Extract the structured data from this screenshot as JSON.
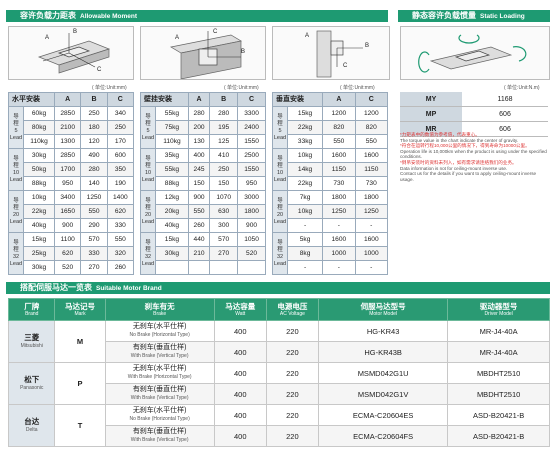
{
  "moment_header": {
    "cn": "容许负载力距表",
    "en": "Allowable Moment"
  },
  "static_header": {
    "cn": "静态容许负载惯量",
    "en": "Static Loading Moment"
  },
  "unit_text": "( 单位:Unit:mm)",
  "unit_text2": "( 单位:Unit:N.m)",
  "fig_labels": {
    "f1": [
      "A",
      "B",
      "C"
    ],
    "f2": [
      "A",
      "B",
      "C"
    ],
    "f3": [
      "A",
      "B",
      "C"
    ]
  },
  "horizontal": {
    "title": "水平安装",
    "cols": [
      "A",
      "B",
      "C"
    ],
    "groups": [
      {
        "lead": [
          "导",
          "程",
          "5",
          "Lead"
        ],
        "rows": [
          [
            "60kg",
            "2850",
            "250",
            "340"
          ],
          [
            "80kg",
            "2100",
            "180",
            "250"
          ],
          [
            "110kg",
            "1300",
            "120",
            "170"
          ]
        ]
      },
      {
        "lead": [
          "导",
          "程",
          "10",
          "Lead"
        ],
        "rows": [
          [
            "30kg",
            "2850",
            "490",
            "600"
          ],
          [
            "50kg",
            "1700",
            "280",
            "350"
          ],
          [
            "88kg",
            "950",
            "140",
            "190"
          ]
        ]
      },
      {
        "lead": [
          "导",
          "程",
          "20",
          "Lead"
        ],
        "rows": [
          [
            "10kg",
            "3400",
            "1250",
            "1400"
          ],
          [
            "22kg",
            "1650",
            "550",
            "620"
          ],
          [
            "40kg",
            "900",
            "290",
            "330"
          ]
        ]
      },
      {
        "lead": [
          "导",
          "程",
          "32",
          "Lead"
        ],
        "rows": [
          [
            "15kg",
            "1100",
            "570",
            "550"
          ],
          [
            "25kg",
            "620",
            "330",
            "320"
          ],
          [
            "30kg",
            "520",
            "270",
            "260"
          ]
        ]
      }
    ]
  },
  "wall": {
    "title": "壁挂安装",
    "cols": [
      "A",
      "B",
      "C"
    ],
    "groups": [
      {
        "lead": [
          "导",
          "程",
          "5",
          "Lead"
        ],
        "rows": [
          [
            "55kg",
            "280",
            "280",
            "3300"
          ],
          [
            "75kg",
            "200",
            "195",
            "2400"
          ],
          [
            "110kg",
            "130",
            "125",
            "1550"
          ]
        ]
      },
      {
        "lead": [
          "导",
          "程",
          "10",
          "Lead"
        ],
        "rows": [
          [
            "35kg",
            "400",
            "410",
            "2500"
          ],
          [
            "55kg",
            "245",
            "250",
            "1550"
          ],
          [
            "88kg",
            "150",
            "150",
            "950"
          ]
        ]
      },
      {
        "lead": [
          "导",
          "程",
          "20",
          "Lead"
        ],
        "rows": [
          [
            "12kg",
            "900",
            "1070",
            "3000"
          ],
          [
            "20kg",
            "550",
            "630",
            "1800"
          ],
          [
            "40kg",
            "260",
            "300",
            "900"
          ]
        ]
      },
      {
        "lead": [
          "导",
          "程",
          "32",
          "Lead"
        ],
        "rows": [
          [
            "15kg",
            "440",
            "570",
            "1050"
          ],
          [
            "30kg",
            "210",
            "270",
            "520"
          ],
          [
            "",
            "",
            "",
            ""
          ]
        ]
      }
    ]
  },
  "vertical": {
    "title": "垂直安装",
    "cols": [
      "A",
      "C"
    ],
    "groups": [
      {
        "lead": [
          "导",
          "程",
          "5",
          "Lead"
        ],
        "rows": [
          [
            "15kg",
            "1200",
            "1200"
          ],
          [
            "22kg",
            "820",
            "820"
          ],
          [
            "33kg",
            "550",
            "550"
          ]
        ]
      },
      {
        "lead": [
          "导",
          "程",
          "10",
          "Lead"
        ],
        "rows": [
          [
            "10kg",
            "1600",
            "1600"
          ],
          [
            "14kg",
            "1150",
            "1150"
          ],
          [
            "22kg",
            "730",
            "730"
          ]
        ]
      },
      {
        "lead": [
          "导",
          "程",
          "20",
          "Lead"
        ],
        "rows": [
          [
            "7kg",
            "1800",
            "1800"
          ],
          [
            "10kg",
            "1250",
            "1250"
          ],
          [
            "-",
            "-",
            "-"
          ]
        ]
      },
      {
        "lead": [
          "导",
          "程",
          "32",
          "Lead"
        ],
        "rows": [
          [
            "5kg",
            "1600",
            "1600"
          ],
          [
            "8kg",
            "1000",
            "1000"
          ],
          [
            "-",
            "-",
            "-"
          ]
        ]
      }
    ]
  },
  "static_rows": [
    [
      "MY",
      "1168"
    ],
    [
      "MP",
      "606"
    ],
    [
      "MR",
      "606"
    ]
  ],
  "notes": [
    {
      "t": "*力矩表中的数值为参考值，代表重心。",
      "red": true
    },
    {
      "t": "The torque value in the chart indicate the center of gravity.",
      "red": false
    },
    {
      "t": "*符合在运转行程10,000公里的情况下，得到寿命为10000公里。",
      "red": true
    },
    {
      "t": "Operation life is 10,000km when the product is using under the specified conditions.",
      "red": false
    },
    {
      "t": "*倒吊安装时的资料未列入，如有需求请连络我们的业务。",
      "red": true
    },
    {
      "t": "Data information is not for ceiling-mount inverse use.",
      "red": false
    },
    {
      "t": "Contact us for the details if you want to apply ceiling-mount inverse usage.",
      "red": false
    }
  ],
  "motor_header": {
    "cn": "搭配伺服马达一览表",
    "en": "Suitable Motor Brand"
  },
  "motor_cols": [
    {
      "cn": "厂牌",
      "en": "Brand"
    },
    {
      "cn": "马达记号",
      "en": "Mark"
    },
    {
      "cn": "刹车有无",
      "en": "Brake"
    },
    {
      "cn": "马达容量",
      "en": "Watt"
    },
    {
      "cn": "电源电压",
      "en": "AC Voltage"
    },
    {
      "cn": "伺服马达型号",
      "en": "Motor Model"
    },
    {
      "cn": "驱动器型号",
      "en": "Driver Model"
    }
  ],
  "motor_brands": [
    {
      "cn": "三菱",
      "en": "Mitsubishi",
      "mark": "M",
      "rows": [
        {
          "brake_cn": "无刹车(水平仕样)",
          "brake_en": "No Brake (Horizontal Type)",
          "watt": "400",
          "volt": "220",
          "model": "HG-KR43",
          "driver": "MR-J4-40A"
        },
        {
          "brake_cn": "有刹车(垂直仕样)",
          "brake_en": "With Brake (Vertical Type)",
          "watt": "400",
          "volt": "220",
          "model": "HG-KR43B",
          "driver": "MR-J4-40A"
        }
      ]
    },
    {
      "cn": "松下",
      "en": "Panasonic",
      "mark": "P",
      "rows": [
        {
          "brake_cn": "无刹车(水平仕样)",
          "brake_en": "With Brake (Horizontal Type)",
          "watt": "400",
          "volt": "220",
          "model": "MSMD042G1U",
          "driver": "MBDHT2510"
        },
        {
          "brake_cn": "有刹车(垂直仕样)",
          "brake_en": "With Brake (Vertical Type)",
          "watt": "400",
          "volt": "220",
          "model": "MSMD042G1V",
          "driver": "MBDHT2510"
        }
      ]
    },
    {
      "cn": "台达",
      "en": "Delta",
      "mark": "T",
      "rows": [
        {
          "brake_cn": "无刹车(水平仕样)",
          "brake_en": "No Brake (Horizontal Type)",
          "watt": "400",
          "volt": "220",
          "model": "ECMA-C20604ES",
          "driver": "ASD-B20421-B"
        },
        {
          "brake_cn": "有刹车(垂直仕样)",
          "brake_en": "With Brake (Vertical Type)",
          "watt": "400",
          "volt": "220",
          "model": "ECMA-C20604FS",
          "driver": "ASD-B20421-B"
        }
      ]
    }
  ]
}
